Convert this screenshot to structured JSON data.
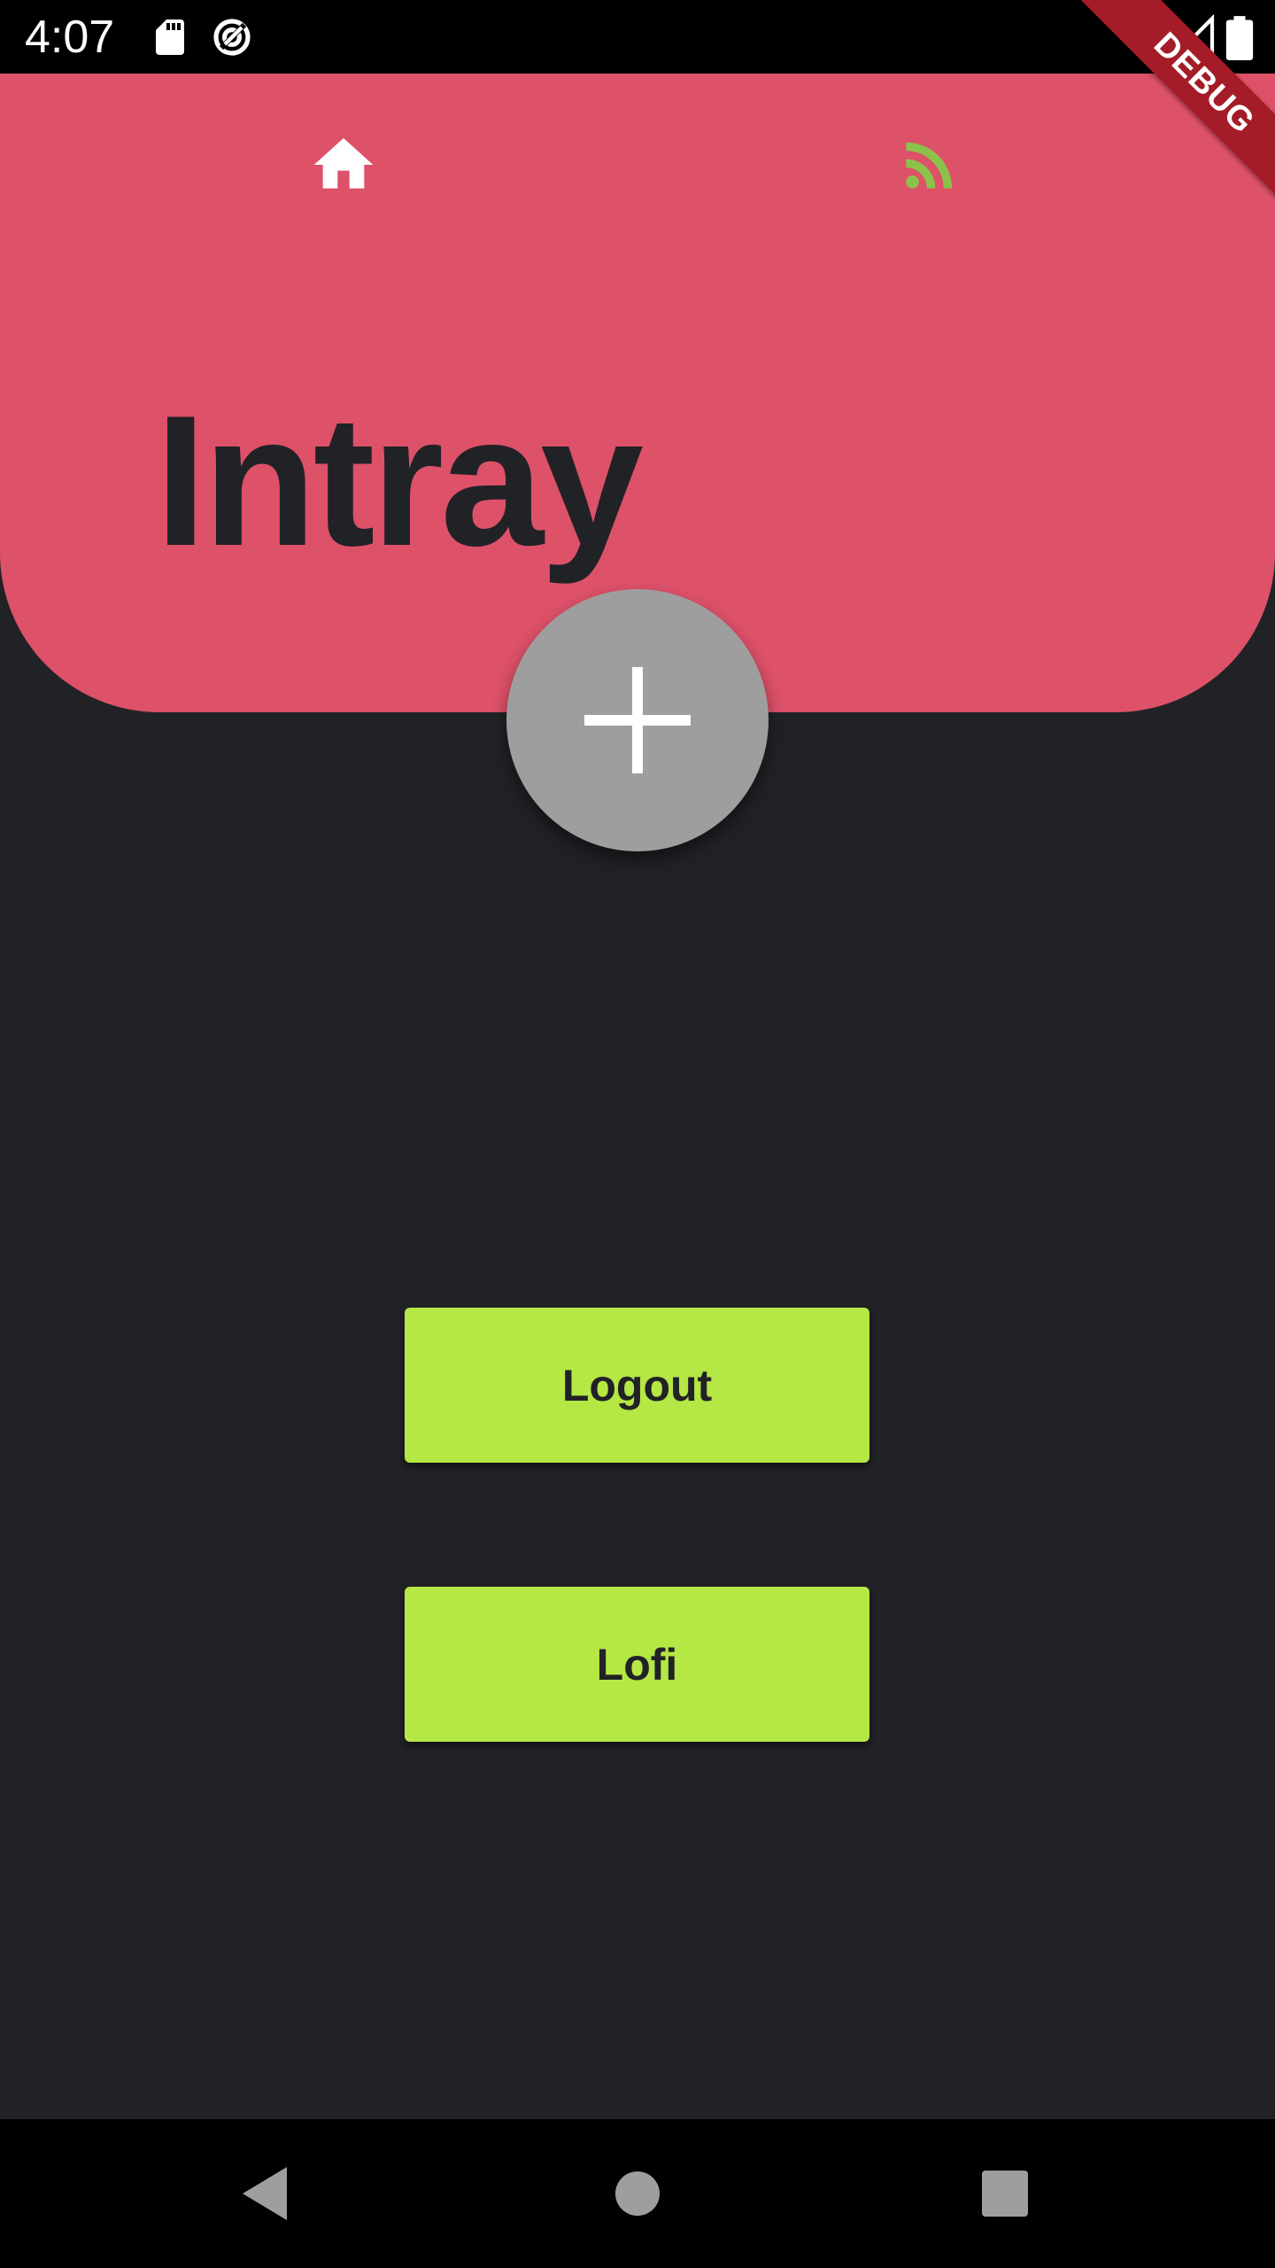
{
  "status_bar": {
    "time": "4:07",
    "icons": [
      "sd-card-icon",
      "sync-icon",
      "wifi-icon",
      "signal-icon",
      "battery-icon"
    ]
  },
  "header": {
    "title": "Intray",
    "nav": [
      {
        "icon": "home-icon",
        "color": "#ffffff"
      },
      {
        "icon": "rss-feed-icon",
        "color": "#8bc34a"
      }
    ],
    "background_color": "#dd5169"
  },
  "fab": {
    "icon": "plus-icon",
    "color": "#9e9e9e"
  },
  "buttons": {
    "logout_label": "Logout",
    "lofi_label": "Lofi",
    "color": "#b5e745"
  },
  "debug_banner": {
    "label": "DEBUG",
    "color": "#a31c27"
  },
  "system_nav": {
    "icons": [
      "back-icon",
      "home-circle-icon",
      "recents-icon"
    ]
  },
  "colors": {
    "background": "#212226",
    "accent": "#dd5169",
    "button": "#b5e745"
  }
}
